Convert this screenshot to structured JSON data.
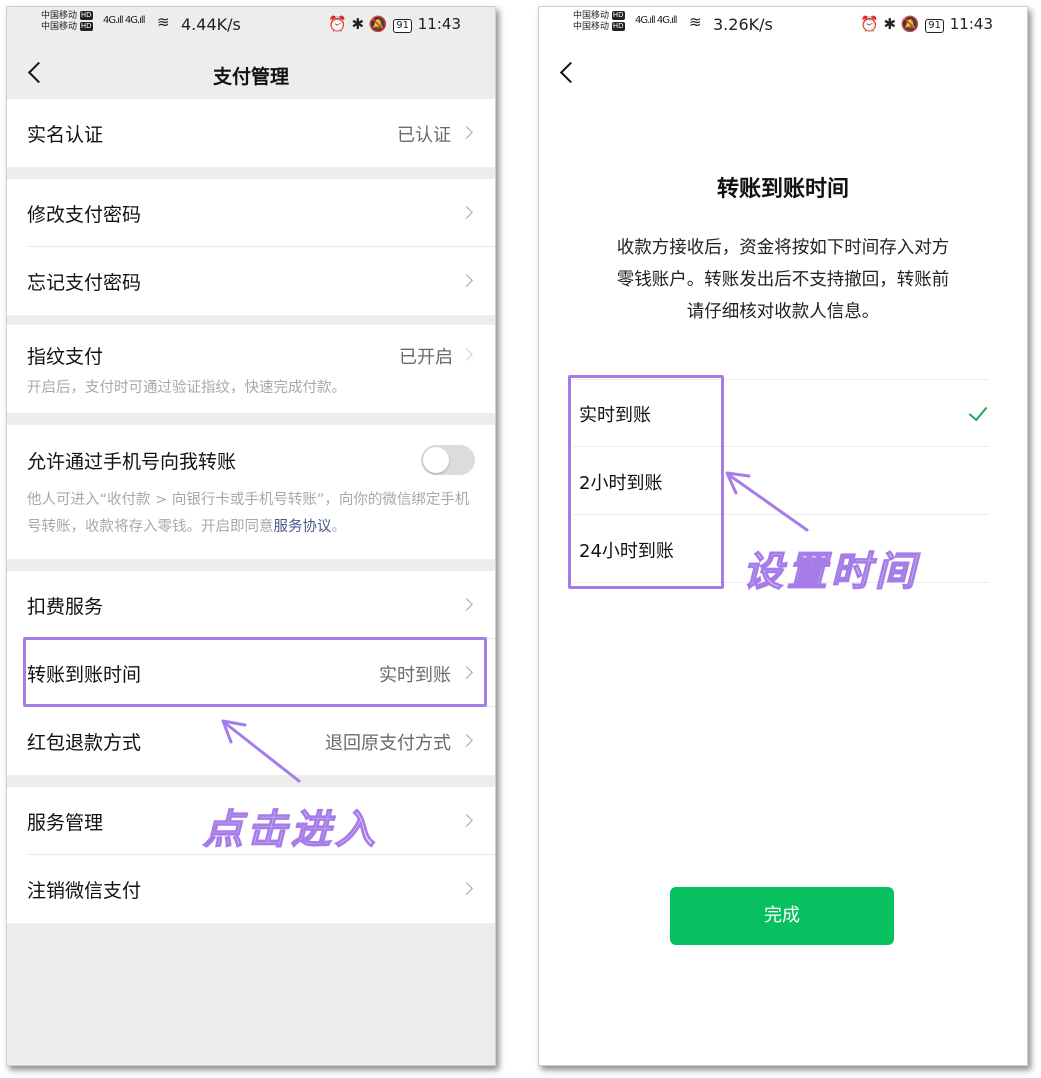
{
  "status_left": {
    "carrier1": "中国移动",
    "carrier2": "中国移动",
    "hd": "HD",
    "net": "4G",
    "speed": "4.44K/s"
  },
  "status_right": {
    "carrier1": "中国移动",
    "carrier2": "中国移动",
    "hd": "HD",
    "net": "4G",
    "speed": "3.26K/s"
  },
  "status_common": {
    "battery": "91",
    "time": "11:43",
    "status_icons": "⏰ ✱ 🔕"
  },
  "left": {
    "title": "支付管理",
    "rows": {
      "real_name": {
        "label": "实名认证",
        "value": "已认证"
      },
      "change_pwd": {
        "label": "修改支付密码"
      },
      "forgot_pwd": {
        "label": "忘记支付密码"
      },
      "fingerprint": {
        "label": "指纹支付",
        "value": "已开启",
        "desc": "开启后，支付时可通过验证指纹，快速完成付款。"
      },
      "phone_transfer": {
        "label": "允许通过手机号向我转账",
        "toggle_on": false,
        "desc": "他人可进入“收付款 > 向银行卡或手机号转账”，向你的微信绑定手机号转账，收款将存入零钱。开启即同意",
        "link": "服务协议",
        "desc_end": "。"
      },
      "deduction": {
        "label": "扣费服务"
      },
      "arrival_time": {
        "label": "转账到账时间",
        "value": "实时到账"
      },
      "red_packet_refund": {
        "label": "红包退款方式",
        "value": "退回原支付方式"
      },
      "service_mgmt": {
        "label": "服务管理"
      },
      "close_pay": {
        "label": "注销微信支付"
      }
    },
    "annotation": "点击进入"
  },
  "right": {
    "heading": "转账到账时间",
    "description_lines": [
      "收款方接收后，资金将按如下时间存入对方",
      "零钱账户。转账发出后不支持撤回，转账前",
      "请仔细核对收款人信息。"
    ],
    "options": [
      "实时到账",
      "2小时到账",
      "24小时到账"
    ],
    "selected_index": 0,
    "done_label": "完成",
    "annotation": "设置时间"
  },
  "colors": {
    "accent_green": "#07c160",
    "highlight_purple": "#a67ce8",
    "link_blue": "#4a5a88",
    "page_bg": "#ededed"
  }
}
